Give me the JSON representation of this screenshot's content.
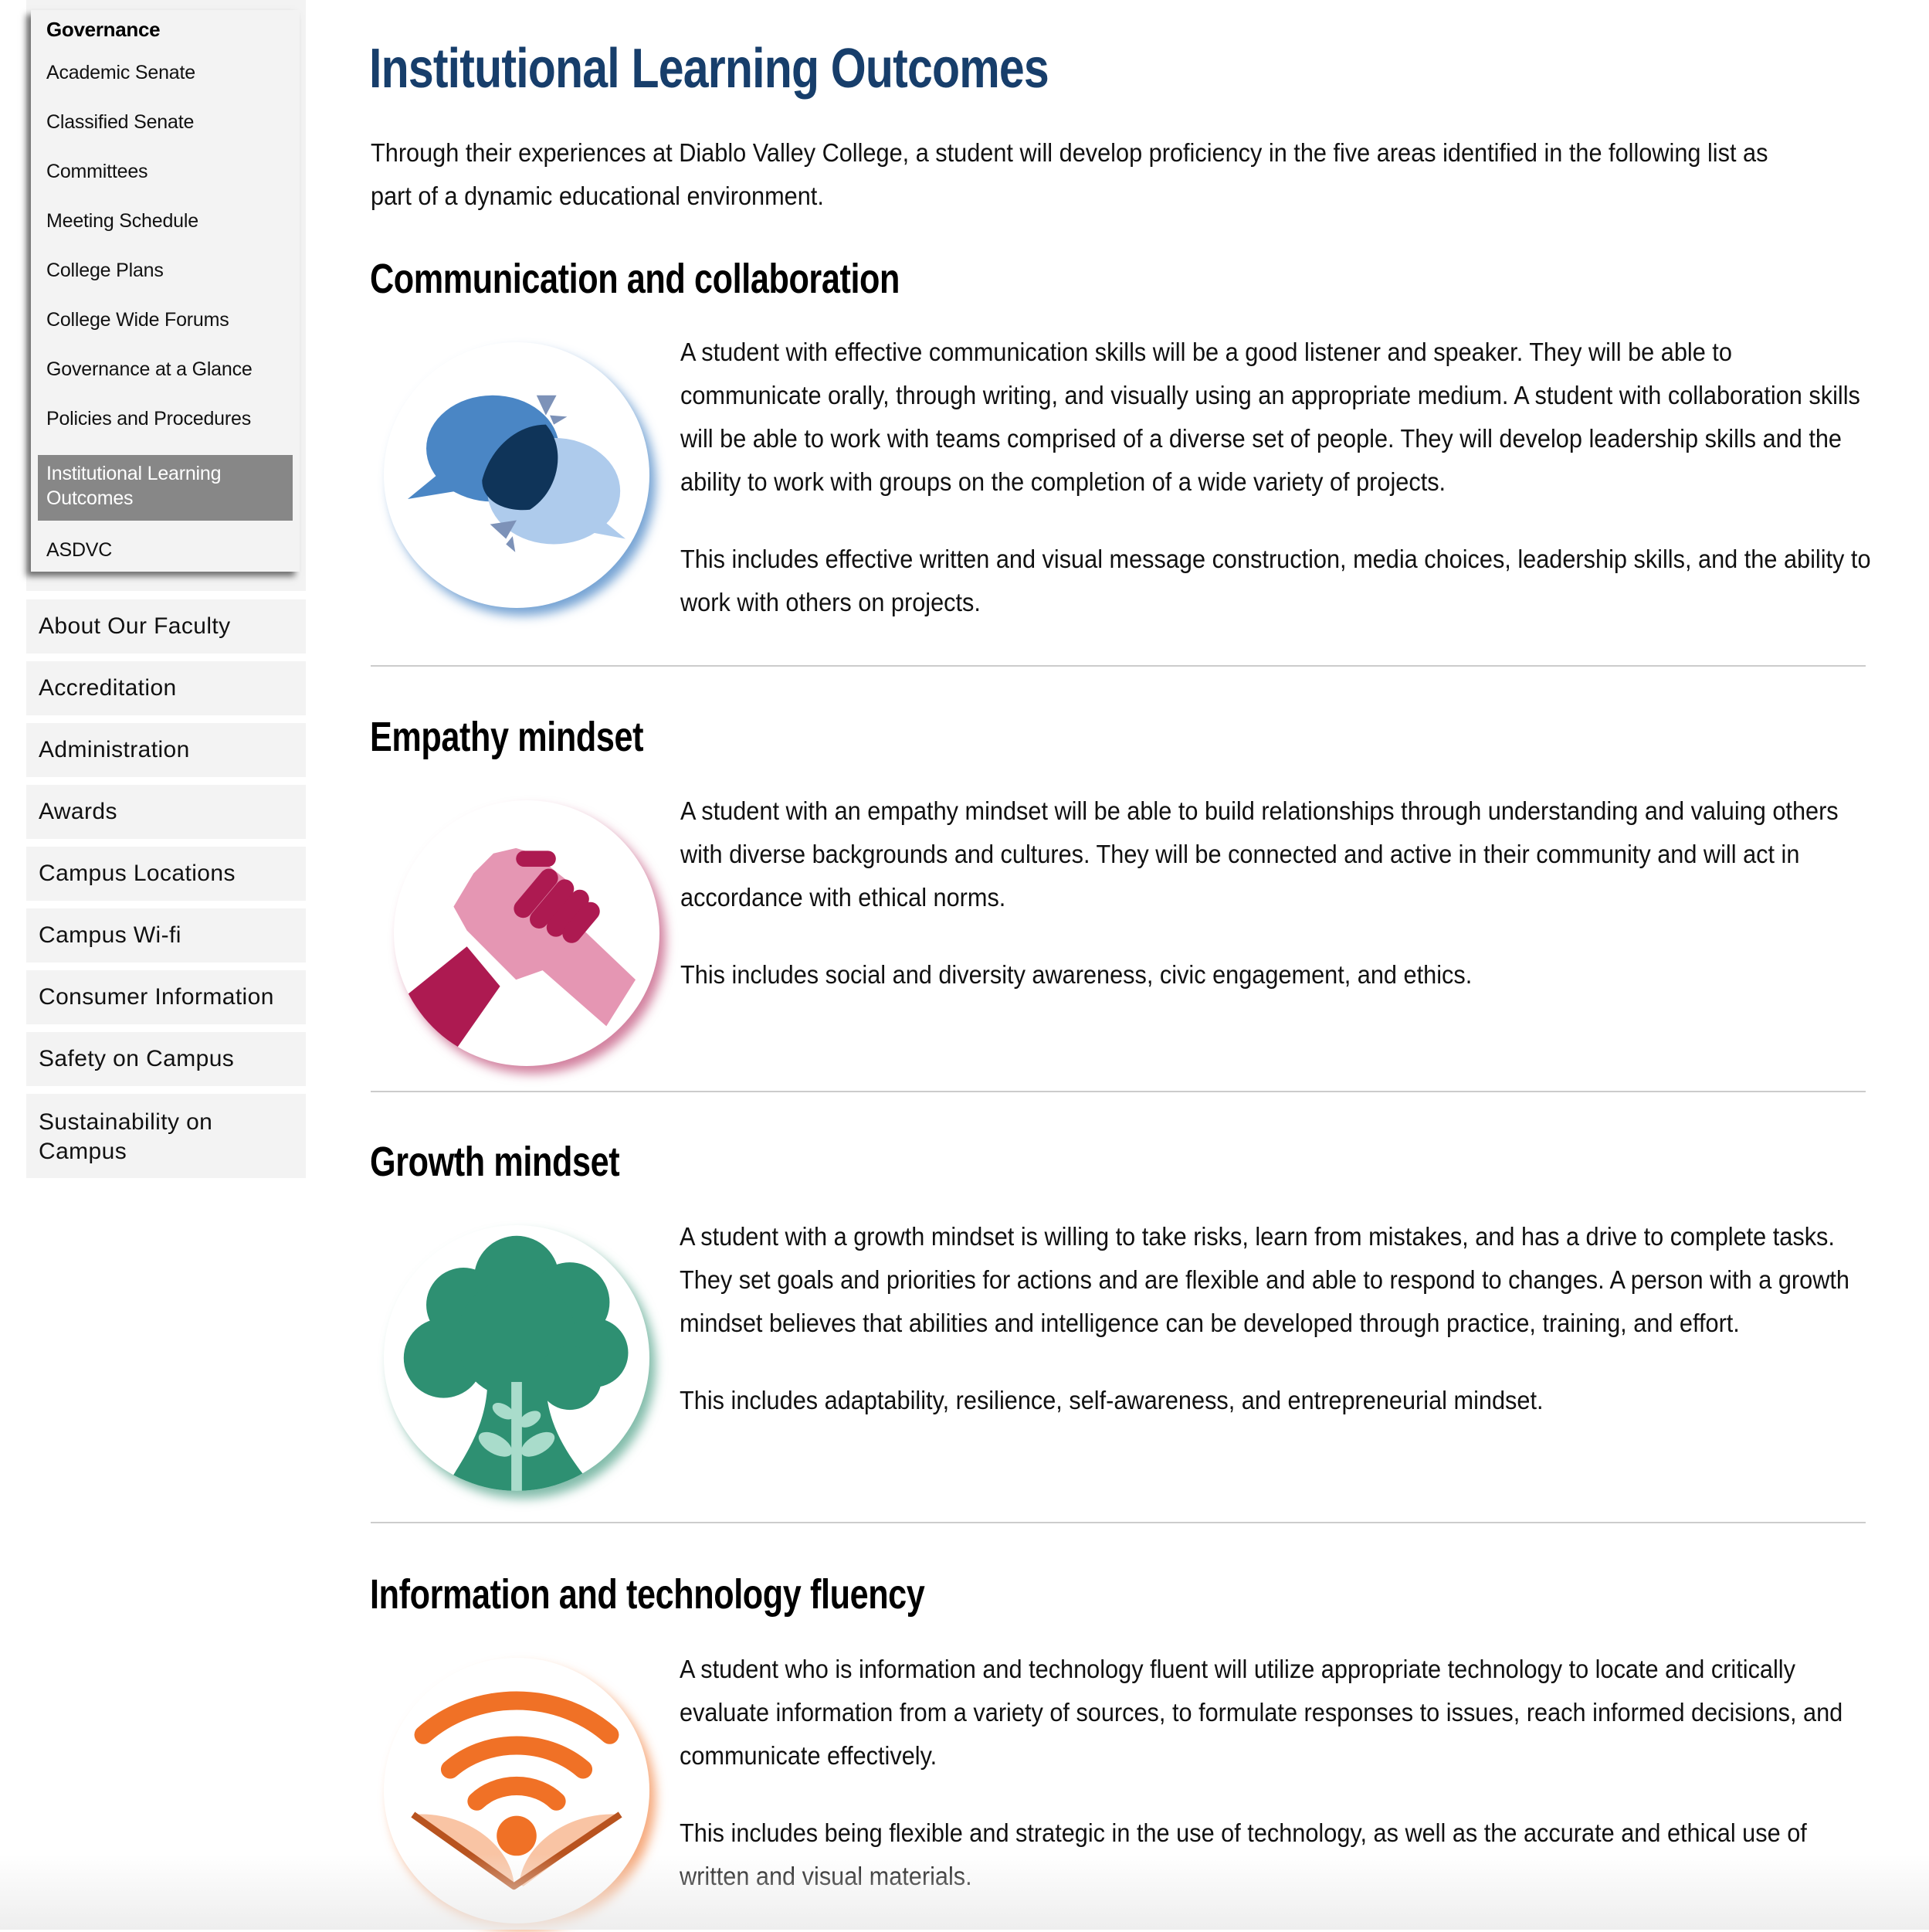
{
  "sidebar": {
    "governance": {
      "header": "Governance",
      "items": [
        {
          "label": "Academic Senate"
        },
        {
          "label": "Classified Senate"
        },
        {
          "label": "Committees"
        },
        {
          "label": "Meeting Schedule"
        },
        {
          "label": "College Plans"
        },
        {
          "label": "College Wide Forums"
        },
        {
          "label": "Governance at a Glance"
        },
        {
          "label": "Policies and Procedures"
        },
        {
          "label": "Institutional Learning Outcomes",
          "selected": true
        },
        {
          "label": "ASDVC"
        }
      ]
    },
    "nav_items": [
      {
        "label": "About Our Faculty"
      },
      {
        "label": "Accreditation"
      },
      {
        "label": "Administration"
      },
      {
        "label": "Awards"
      },
      {
        "label": "Campus Locations"
      },
      {
        "label": "Campus Wi-fi"
      },
      {
        "label": "Consumer Information"
      },
      {
        "label": "Safety on Campus"
      },
      {
        "label": "Sustainability on Campus"
      }
    ]
  },
  "main": {
    "title": "Institutional Learning Outcomes",
    "intro": "Through their experiences at Diablo Valley College, a student will develop proficiency in the five areas identified in the following list as part of a dynamic educational environment.",
    "sections": [
      {
        "heading": "Communication and collaboration",
        "icon": "speech-bubbles-icon",
        "color": "#4a86c5",
        "paragraphs": [
          "A student with effective communication skills will be a good listener and speaker. They will be able to communicate orally, through writing, and visually using an appropriate medium. A student with collaboration skills will be able to work with teams comprised of a diverse set of people. They will develop leadership skills and the ability to work with groups on the completion of a wide variety of projects.",
          "This includes effective written and visual message construction, media choices, leadership skills, and the ability to work with others on projects."
        ]
      },
      {
        "heading": "Empathy mindset",
        "icon": "clasped-hands-icon",
        "color": "#ad1a51",
        "paragraphs": [
          "A student with an empathy mindset will be able to build relationships through understanding and valuing others with diverse backgrounds and cultures. They will be connected and active in their community and will act in accordance with ethical norms.",
          "This includes social and diversity awareness, civic engagement, and ethics."
        ]
      },
      {
        "heading": "Growth mindset",
        "icon": "tree-sprout-icon",
        "color": "#2e9072",
        "paragraphs": [
          "A student with a growth mindset is willing to take risks, learn from mistakes, and has a drive to complete tasks. They set goals and priorities for actions and are flexible and able to respond to changes. A person with a growth mindset believes that abilities and intelligence can be developed through practice, training, and effort.",
          "This includes adaptability, resilience, self-awareness, and entrepreneurial mindset."
        ]
      },
      {
        "heading": "Information and technology fluency",
        "icon": "wifi-book-icon",
        "color": "#f07126",
        "paragraphs": [
          "A student who is information and technology fluent will utilize appropriate technology to locate and critically evaluate information from a variety of sources, to formulate responses to issues, reach informed decisions, and communicate effectively.",
          "This includes being flexible and strategic in the use of technology, as well as the accurate and ethical use of written and visual materials."
        ]
      }
    ]
  },
  "colors": {
    "title": "#173e6b",
    "sidebar_bg": "#f3f3f3",
    "selected_bg": "#878787",
    "separator": "#cccccc"
  }
}
